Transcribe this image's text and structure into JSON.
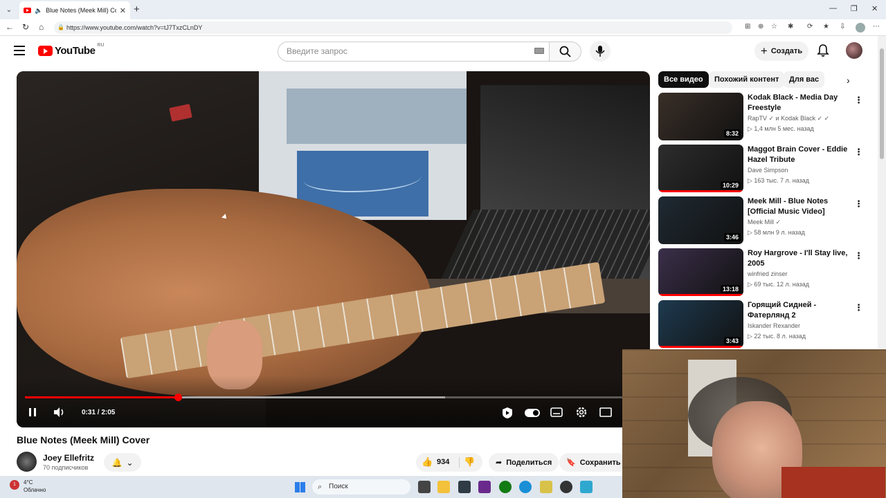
{
  "browser": {
    "tab_title": "Blue Notes (Meek Mill) Cover",
    "url": "https://www.youtube.com/watch?v=tJ7TxzCLnDY"
  },
  "header": {
    "logo_text": "YouTube",
    "region": "RU",
    "search_placeholder": "Введите запрос",
    "create_label": "Создать"
  },
  "player": {
    "time": "0:31 / 2:05",
    "progress": 0.248,
    "buffered": 0.68
  },
  "video": {
    "title": "Blue Notes (Meek Mill) Cover",
    "channel": "Joey Ellefritz",
    "subscribers": "70 подписчиков",
    "likes": "934",
    "share_label": "Поделиться",
    "save_label": "Сохранить"
  },
  "chips": [
    "Все видео",
    "Похожий контент",
    "Для вас"
  ],
  "recommendations": [
    {
      "title": "Kodak Black - Media Day Freestyle",
      "channel": "RapTV ✓ и Kodak Black ✓ ✓",
      "meta": "▷ 1,4 млн  5 мес. назад",
      "duration": "8:32",
      "thumb_color": "#3a2f28",
      "watched": false
    },
    {
      "title": "Maggot Brain Cover - Eddie Hazel Tribute",
      "channel": "Dave Simpson",
      "meta": "▷ 163 тыс.  7 л. назад",
      "duration": "10:29",
      "thumb_color": "#2d2d2d",
      "watched": true
    },
    {
      "title": "Meek Mill - Blue Notes [Official Music Video]",
      "channel": "Meek Mill ✓",
      "meta": "▷ 58 млн  9 л. назад",
      "duration": "3:46",
      "thumb_color": "#1f2a33",
      "watched": false
    },
    {
      "title": "Roy Hargrove - I'll Stay live, 2005",
      "channel": "winfried zinser",
      "meta": "▷ 69 тыс.  12 л. назад",
      "duration": "13:18",
      "thumb_color": "#3b2f4a",
      "watched": true
    },
    {
      "title": "Горящий Сидней - Фатерлянд 2",
      "channel": "Iskander Rexander",
      "meta": "▷ 22 тыс.  8 л. назад",
      "duration": "3:43",
      "thumb_color": "#1e3a4f",
      "watched": true
    }
  ],
  "taskbar": {
    "temperature": "4°C",
    "weather": "Облачно",
    "weather_badge": "1",
    "search_label": "Поиск"
  }
}
